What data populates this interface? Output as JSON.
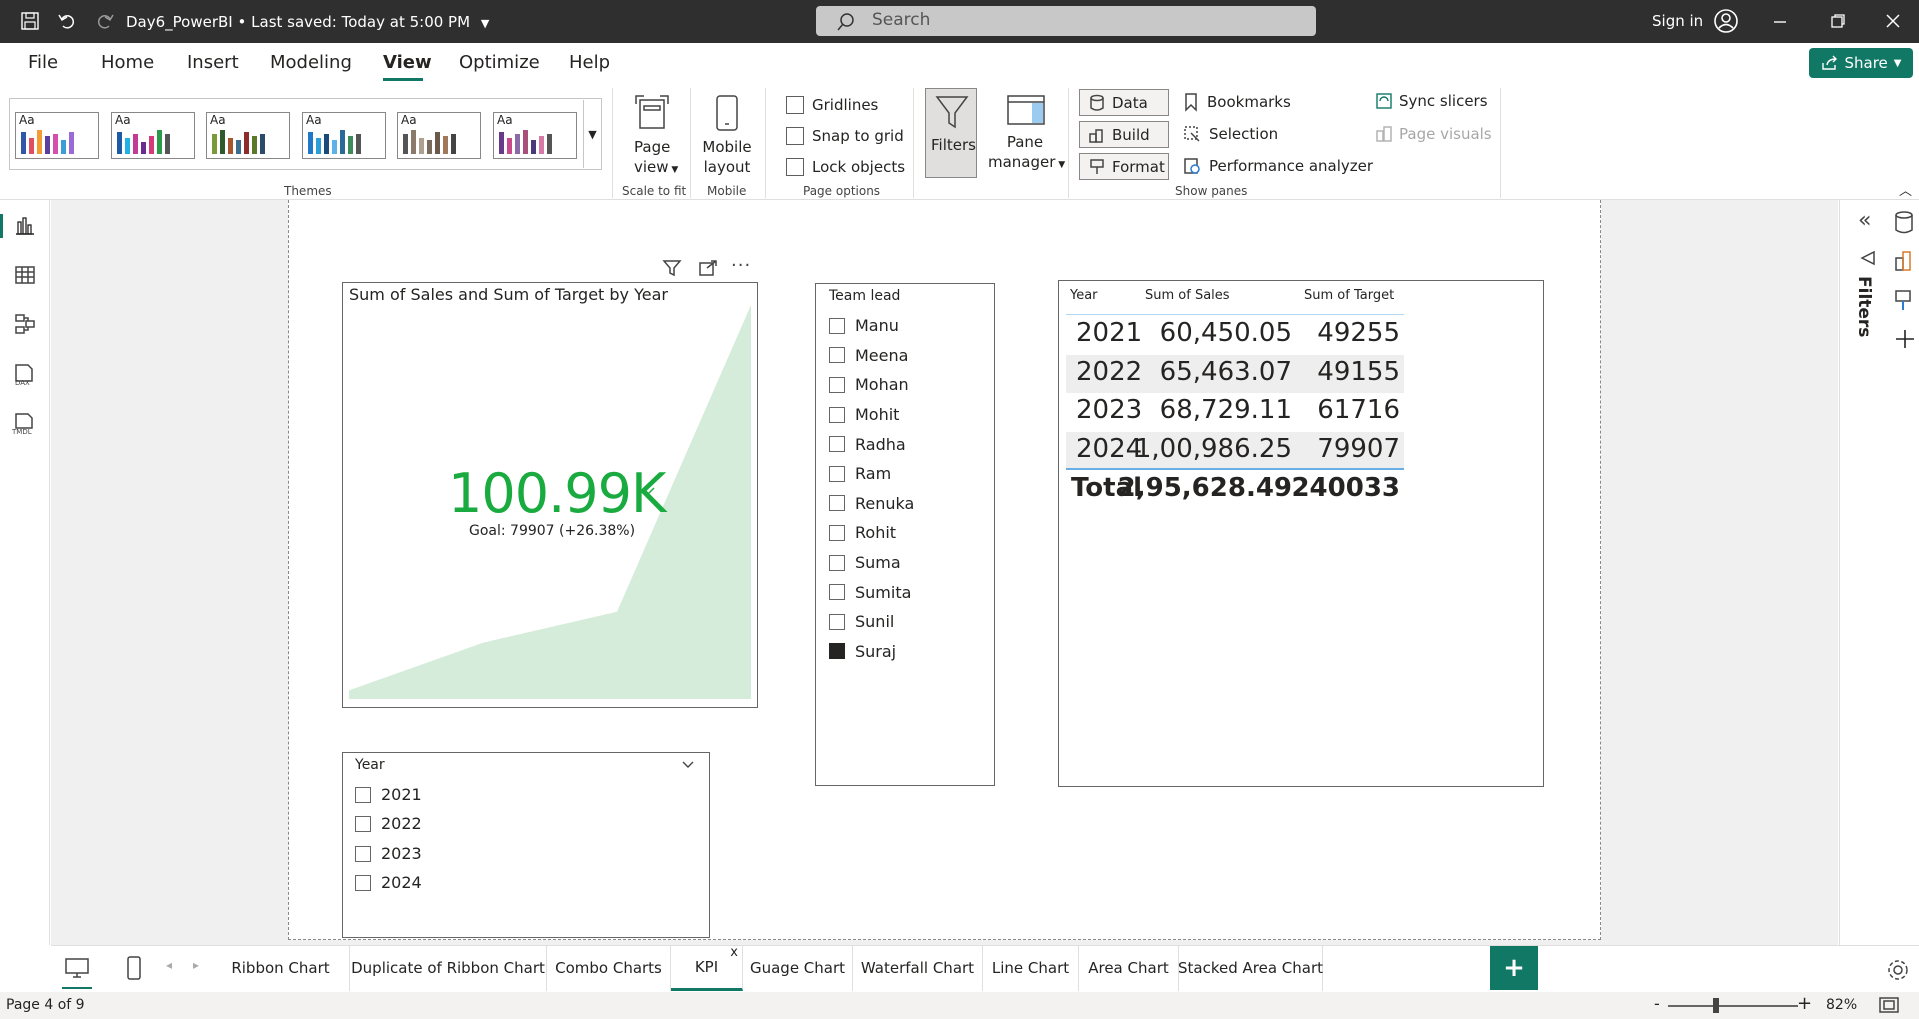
{
  "titlebar": {
    "file_name": "Day6_PowerBI",
    "saved_status": "Last saved: Today at 5:00 PM",
    "search_placeholder": "Search",
    "sign_in": "Sign in"
  },
  "menu": {
    "items": [
      "File",
      "Home",
      "Insert",
      "Modeling",
      "View",
      "Optimize",
      "Help"
    ],
    "active": "View",
    "share_label": "Share"
  },
  "ribbon": {
    "themes_label": "Themes",
    "page_view": {
      "line1": "Page",
      "line2": "view",
      "group": "Scale to fit"
    },
    "mobile": {
      "line1": "Mobile",
      "line2": "layout",
      "group": "Mobile"
    },
    "page_options": {
      "gridlines": "Gridlines",
      "snap": "Snap to grid",
      "lock": "Lock objects",
      "group": "Page options"
    },
    "filters_label": "Filters",
    "pane_manager": {
      "line1": "Pane",
      "line2": "manager"
    },
    "show_panes": {
      "data": "Data",
      "build": "Build",
      "format": "Format",
      "bookmarks": "Bookmarks",
      "selection": "Selection",
      "performance": "Performance analyzer",
      "sync_slicers": "Sync slicers",
      "page_visuals": "Page visuals",
      "group": "Show panes"
    }
  },
  "right_rail": {
    "filters_label": "Filters"
  },
  "kpi": {
    "title": "Sum of Sales and Sum of Target by Year",
    "value": "100.99K",
    "goal": "Goal: 79907 (+26.38%)",
    "trend_values": [
      60450.05,
      65463.07,
      68729.11,
      100986.25
    ],
    "colors": {
      "value": "#1aab40",
      "area": "#d4ecd9"
    }
  },
  "year_slicer": {
    "header": "Year",
    "items": [
      "2021",
      "2022",
      "2023",
      "2024"
    ]
  },
  "team_slicer": {
    "header": "Team lead",
    "items": [
      "Manu",
      "Meena",
      "Mohan",
      "Mohit",
      "Radha",
      "Ram",
      "Renuka",
      "Rohit",
      "Suma",
      "Sumita",
      "Sunil",
      "Suraj"
    ],
    "selected": "Suraj"
  },
  "table": {
    "headers": [
      "Year",
      "Sum of Sales",
      "Sum of Target"
    ],
    "rows": [
      [
        "2021",
        "60,450.05",
        "49255"
      ],
      [
        "2022",
        "65,463.07",
        "49155"
      ],
      [
        "2023",
        "68,729.11",
        "61716"
      ],
      [
        "2024",
        "1,00,986.25",
        "79907"
      ]
    ],
    "total": [
      "Total",
      "2,95,628.49",
      "240033"
    ]
  },
  "tabs": {
    "items": [
      "Ribbon Chart",
      "Duplicate of Ribbon Chart",
      "Combo Charts",
      "KPI",
      "Guage Chart",
      "Waterfall Chart",
      "Line Chart",
      "Area Chart",
      "Stacked Area Chart"
    ],
    "active": "KPI",
    "close": "x",
    "add": "+"
  },
  "status": {
    "page": "Page 4 of 9",
    "zoom": "82%",
    "zoom_minus": "-",
    "zoom_plus": "+"
  },
  "colors": {
    "accent": "#117865",
    "titlebar": "#2f2f2f"
  }
}
